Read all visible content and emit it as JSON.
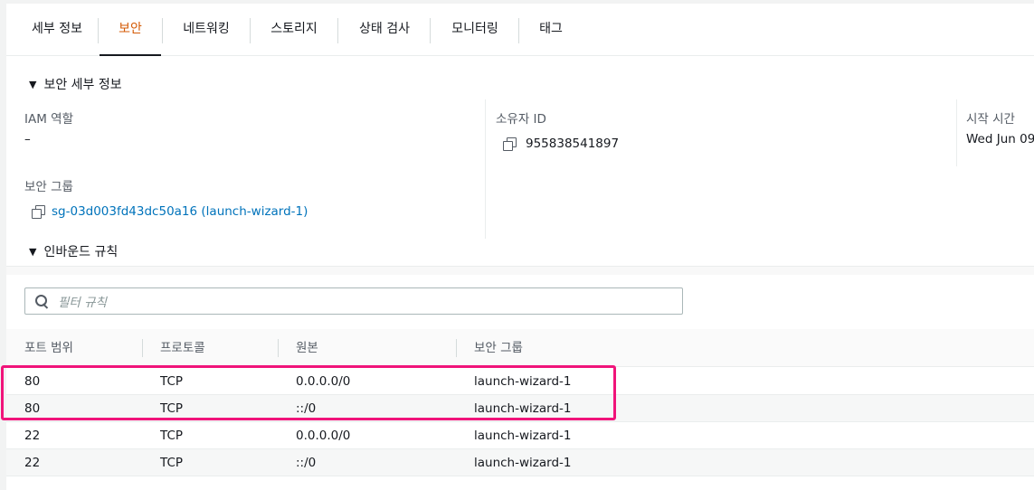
{
  "tabs": [
    {
      "label": "세부 정보",
      "active": false
    },
    {
      "label": "보안",
      "active": true
    },
    {
      "label": "네트워킹",
      "active": false
    },
    {
      "label": "스토리지",
      "active": false
    },
    {
      "label": "상태 검사",
      "active": false
    },
    {
      "label": "모니터링",
      "active": false
    },
    {
      "label": "태그",
      "active": false
    }
  ],
  "security_details": {
    "header": "보안 세부 정보",
    "iam_role_label": "IAM 역할",
    "iam_role_value": "–",
    "owner_id_label": "소유자 ID",
    "owner_id_value": "955838541897",
    "launch_time_label": "시작 시간",
    "launch_time_value": "Wed Jun 09",
    "security_groups_label": "보안 그룹",
    "security_group_link": "sg-03d003fd43dc50a16 (launch-wizard-1)"
  },
  "inbound_rules": {
    "header": "인바운드 규칙",
    "filter_placeholder": "필터 규칙",
    "columns": [
      "포트 범위",
      "프로토콜",
      "원본",
      "보안 그룹"
    ],
    "rows": [
      {
        "port": "80",
        "protocol": "TCP",
        "source": "0.0.0.0/0",
        "security_group": "launch-wizard-1"
      },
      {
        "port": "80",
        "protocol": "TCP",
        "source": "::/0",
        "security_group": "launch-wizard-1"
      },
      {
        "port": "22",
        "protocol": "TCP",
        "source": "0.0.0.0/0",
        "security_group": "launch-wizard-1"
      },
      {
        "port": "22",
        "protocol": "TCP",
        "source": "::/0",
        "security_group": "launch-wizard-1"
      }
    ]
  },
  "colors": {
    "active_tab": "#d45b07",
    "link": "#0073bb",
    "highlight_box": "#f0147a"
  }
}
